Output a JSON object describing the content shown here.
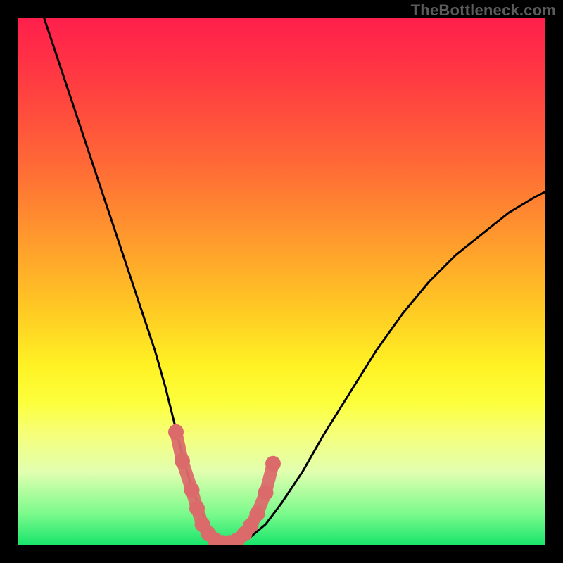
{
  "watermark": "TheBottleneck.com",
  "chart_data": {
    "type": "line",
    "title": "",
    "xlabel": "",
    "ylabel": "",
    "xlim": [
      0,
      100
    ],
    "ylim": [
      0,
      100
    ],
    "grid": false,
    "series": [
      {
        "name": "bottleneck-curve",
        "x": [
          5,
          8,
          11,
          14,
          17,
          20,
          23,
          26,
          28,
          30,
          31.5,
          33,
          34.5,
          36,
          37.5,
          39.5,
          41.5,
          44,
          47,
          50,
          54,
          58,
          63,
          68,
          73,
          78,
          83,
          88,
          93,
          98,
          100
        ],
        "y": [
          100,
          91,
          82,
          73,
          64,
          55,
          46,
          37,
          30,
          22,
          16,
          11,
          7,
          4,
          1.5,
          0.5,
          0.5,
          1.5,
          4,
          8,
          14,
          21,
          29,
          37,
          44,
          50,
          55,
          59,
          63,
          66,
          67
        ],
        "color": "#000000"
      }
    ],
    "markers": {
      "name": "trough-dots",
      "color": "#db6b6b",
      "points_xy": [
        [
          30.0,
          21.5
        ],
        [
          31.2,
          16.0
        ],
        [
          33.0,
          10.5
        ],
        [
          34.0,
          7.0
        ],
        [
          35.0,
          4.0
        ],
        [
          36.2,
          2.2
        ],
        [
          37.4,
          1.0
        ],
        [
          38.8,
          0.5
        ],
        [
          40.2,
          0.5
        ],
        [
          41.6,
          1.0
        ],
        [
          43.0,
          2.2
        ],
        [
          44.2,
          3.8
        ],
        [
          45.4,
          6.0
        ],
        [
          47.0,
          10.0
        ],
        [
          48.4,
          15.5
        ]
      ]
    },
    "gradient_stops": [
      {
        "pos": 0.0,
        "color": "#ff1f4c"
      },
      {
        "pos": 0.05,
        "color": "#ff2a48"
      },
      {
        "pos": 0.14,
        "color": "#ff4140"
      },
      {
        "pos": 0.28,
        "color": "#ff6a36"
      },
      {
        "pos": 0.42,
        "color": "#ff9a2d"
      },
      {
        "pos": 0.55,
        "color": "#ffc824"
      },
      {
        "pos": 0.66,
        "color": "#fff224"
      },
      {
        "pos": 0.73,
        "color": "#fcff3c"
      },
      {
        "pos": 0.79,
        "color": "#f6ff7a"
      },
      {
        "pos": 0.86,
        "color": "#e2ffb0"
      },
      {
        "pos": 0.94,
        "color": "#7bfa8c"
      },
      {
        "pos": 1.0,
        "color": "#17e56b"
      }
    ]
  }
}
